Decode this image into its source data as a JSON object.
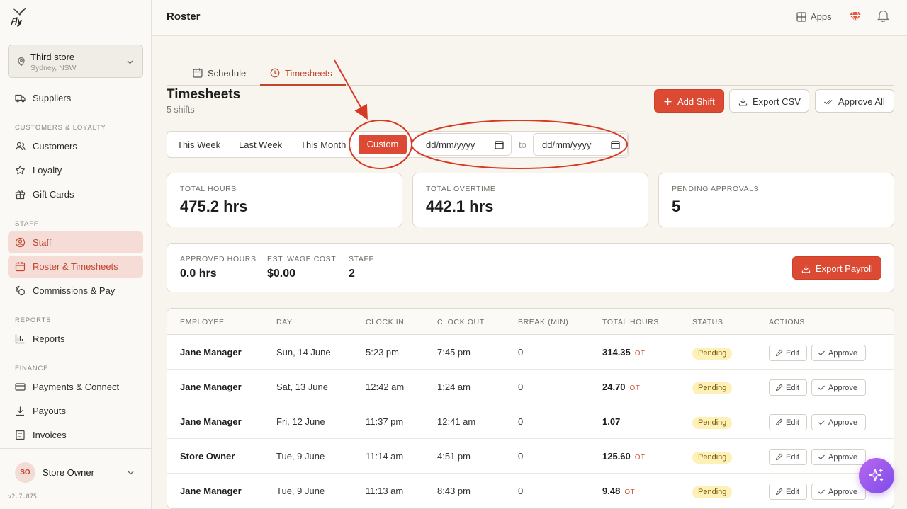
{
  "app": {
    "version": "v2.7.875",
    "colors": {
      "accent": "#dd4a33",
      "active_bg": "#f5dcd7",
      "pending_bg": "#fdf1b8"
    }
  },
  "store": {
    "name": "Third store",
    "location": "Sydney, NSW"
  },
  "sidebar": {
    "top_items": [
      {
        "label": "Suppliers",
        "icon": "truck-icon"
      }
    ],
    "sections": [
      {
        "title": "CUSTOMERS & LOYALTY",
        "items": [
          {
            "label": "Customers",
            "icon": "users-icon"
          },
          {
            "label": "Loyalty",
            "icon": "star-icon"
          },
          {
            "label": "Gift Cards",
            "icon": "gift-icon"
          }
        ]
      },
      {
        "title": "STAFF",
        "items": [
          {
            "label": "Staff",
            "icon": "user-circle-icon"
          },
          {
            "label": "Roster & Timesheets",
            "icon": "calendar-icon"
          },
          {
            "label": "Commissions & Pay",
            "icon": "coins-icon"
          }
        ]
      },
      {
        "title": "REPORTS",
        "items": [
          {
            "label": "Reports",
            "icon": "bar-chart-icon"
          }
        ]
      },
      {
        "title": "FINANCE",
        "items": [
          {
            "label": "Payments & Connect",
            "icon": "credit-card-icon"
          },
          {
            "label": "Payouts",
            "icon": "download-icon"
          },
          {
            "label": "Invoices",
            "icon": "receipt-icon"
          }
        ]
      }
    ]
  },
  "user": {
    "initials": "SO",
    "name": "Store Owner"
  },
  "header": {
    "title": "Roster",
    "apps_label": "Apps"
  },
  "tabs": [
    {
      "label": "Schedule",
      "icon": "calendar-icon"
    },
    {
      "label": "Timesheets",
      "icon": "clock-icon"
    }
  ],
  "page": {
    "heading": "Timesheets",
    "subheading": "5 shifts",
    "actions": {
      "add_shift": "Add Shift",
      "export_csv": "Export CSV",
      "approve_all": "Approve All"
    }
  },
  "filters": {
    "options": [
      "This Week",
      "Last Week",
      "This Month"
    ],
    "selected": "Custom",
    "date_from": "dd/mm/yyyy",
    "date_to": "dd/mm/yyyy",
    "to_label": "to"
  },
  "stats": [
    {
      "label": "TOTAL HOURS",
      "value": "475.2 hrs"
    },
    {
      "label": "TOTAL OVERTIME",
      "value": "442.1 hrs"
    },
    {
      "label": "PENDING APPROVALS",
      "value": "5"
    }
  ],
  "summary": {
    "items": [
      {
        "label": "APPROVED HOURS",
        "value": "0.0 hrs"
      },
      {
        "label": "EST. WAGE COST",
        "value": "$0.00"
      },
      {
        "label": "STAFF",
        "value": "2"
      }
    ],
    "export_payroll": "Export Payroll"
  },
  "table": {
    "columns": [
      "EMPLOYEE",
      "DAY",
      "CLOCK IN",
      "CLOCK OUT",
      "BREAK (MIN)",
      "TOTAL HOURS",
      "STATUS",
      "ACTIONS"
    ],
    "edit_label": "Edit",
    "approve_label": "Approve",
    "ot_label": "OT",
    "rows": [
      {
        "employee": "Jane Manager",
        "day": "Sun, 14 June",
        "clock_in": "5:23 pm",
        "clock_out": "7:45 pm",
        "break": "0",
        "total": "314.35",
        "ot": "OT",
        "status": "Pending"
      },
      {
        "employee": "Jane Manager",
        "day": "Sat, 13 June",
        "clock_in": "12:42 am",
        "clock_out": "1:24 am",
        "break": "0",
        "total": "24.70",
        "ot": "OT",
        "status": "Pending"
      },
      {
        "employee": "Jane Manager",
        "day": "Fri, 12 June",
        "clock_in": "11:37 pm",
        "clock_out": "12:41 am",
        "break": "0",
        "total": "1.07",
        "ot": "",
        "status": "Pending"
      },
      {
        "employee": "Store Owner",
        "day": "Tue, 9 June",
        "clock_in": "11:14 am",
        "clock_out": "4:51 pm",
        "break": "0",
        "total": "125.60",
        "ot": "OT",
        "status": "Pending"
      },
      {
        "employee": "Jane Manager",
        "day": "Tue, 9 June",
        "clock_in": "11:13 am",
        "clock_out": "8:43 pm",
        "break": "0",
        "total": "9.48",
        "ot": "OT",
        "status": "Pending"
      }
    ]
  }
}
